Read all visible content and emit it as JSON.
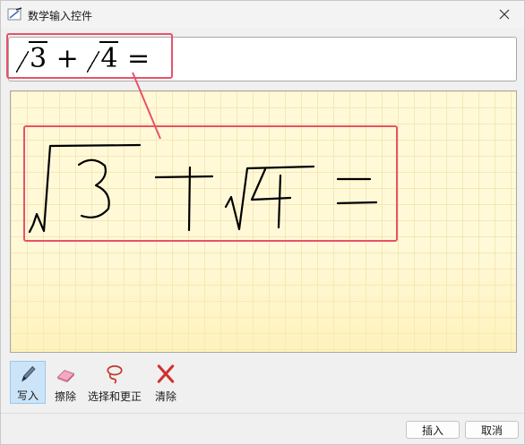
{
  "window": {
    "title": "数学输入控件"
  },
  "preview": {
    "expression_sqrt1": "3",
    "expression_plus": "+",
    "expression_sqrt2": "4",
    "expression_eq": "="
  },
  "toolbar": {
    "tools": [
      {
        "label": "写入",
        "icon": "pen-icon",
        "selected": true
      },
      {
        "label": "擦除",
        "icon": "eraser-icon",
        "selected": false
      },
      {
        "label": "选择和更正",
        "icon": "lasso-icon",
        "selected": false
      },
      {
        "label": "清除",
        "icon": "clear-x-icon",
        "selected": false
      }
    ]
  },
  "footer": {
    "insert_label": "插入",
    "cancel_label": "取消"
  },
  "colors": {
    "highlight": "#e8526a",
    "selected_tool_bg": "#cce4f7",
    "canvas_bg": "#fff9d8"
  }
}
